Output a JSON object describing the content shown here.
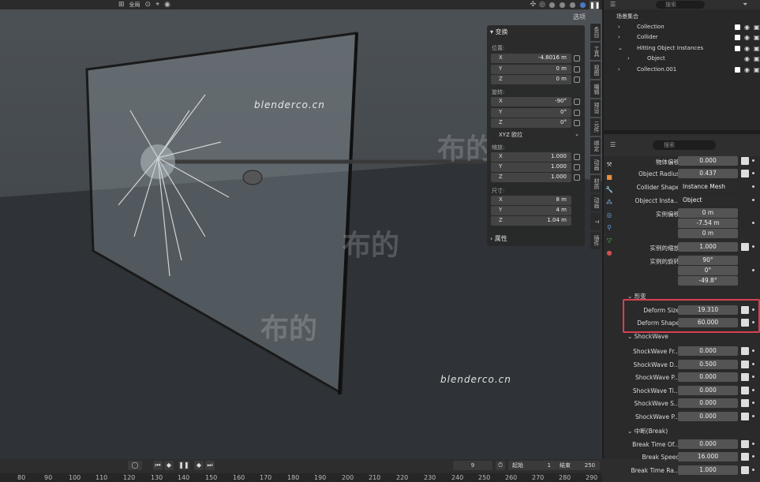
{
  "viewport": {
    "header": {
      "global_label": "全局",
      "options_label": "选项"
    },
    "watermarks": [
      "blenderco.cn",
      "blenderco.cn"
    ],
    "watermark_cn": [
      "布的",
      "布的",
      "布的"
    ],
    "npanel": {
      "title": "变换",
      "location_label": "位置:",
      "location": [
        {
          "axis": "X",
          "value": "-4.8016 m"
        },
        {
          "axis": "Y",
          "value": "0 m"
        },
        {
          "axis": "Z",
          "value": "0 m"
        }
      ],
      "rotation_label": "旋转:",
      "rotation": [
        {
          "axis": "X",
          "value": "-90°"
        },
        {
          "axis": "Y",
          "value": "0°"
        },
        {
          "axis": "Z",
          "value": "0°"
        }
      ],
      "rotation_mode": "XYZ 欧拉",
      "scale_label": "缩放:",
      "scale": [
        {
          "axis": "X",
          "value": "1.000"
        },
        {
          "axis": "Y",
          "value": "1.000"
        },
        {
          "axis": "Z",
          "value": "1.000"
        }
      ],
      "dimensions_label": "尺寸:",
      "dimensions": [
        {
          "axis": "X",
          "value": "8 m"
        },
        {
          "axis": "Y",
          "value": "4 m"
        },
        {
          "axis": "Z",
          "value": "1.04 m"
        }
      ],
      "properties_label": "属性"
    },
    "side_tabs": [
      "条目",
      "工具",
      "视图",
      "编辑",
      "预设",
      "元件",
      "绑定",
      "动画",
      "材质",
      "动画",
      "T",
      "插件"
    ]
  },
  "timeline": {
    "frame": "9",
    "start_label": "起始",
    "start_value": "1",
    "end_label": "结束",
    "end_value": "250",
    "ruler": [
      "80",
      "90",
      "100",
      "110",
      "120",
      "130",
      "140",
      "150",
      "160",
      "170",
      "180",
      "190",
      "200",
      "210",
      "220",
      "230",
      "240",
      "250",
      "260",
      "270",
      "280",
      "290"
    ]
  },
  "outliner": {
    "search_placeholder": "搜索",
    "rows": [
      {
        "label": "场景集合"
      },
      {
        "label": "Collection"
      },
      {
        "label": "Collider"
      },
      {
        "label": "Hitting Object Instances"
      },
      {
        "label": "Object"
      },
      {
        "label": "Collection.001"
      }
    ]
  },
  "properties": {
    "search_placeholder": "搜索",
    "rows": [
      {
        "label": "物体偏移",
        "value": "0.000"
      },
      {
        "label": "Object Radius",
        "value": "0.437"
      },
      {
        "label": "Collider Shape",
        "value": "Instance Mesh"
      },
      {
        "label": "Objecct Insta...",
        "value": "Object"
      },
      {
        "label": "实例偏移",
        "value": "0 m"
      },
      {
        "label": "",
        "value": "-7.54 m"
      },
      {
        "label": "",
        "value": "0 m"
      },
      {
        "label": "实例的缩放",
        "value": "1.000"
      },
      {
        "label": "实例的旋转",
        "value": "90°"
      },
      {
        "label": "",
        "value": "0°"
      },
      {
        "label": "",
        "value": "-49.8°"
      }
    ],
    "deform_section": "形变",
    "deform": [
      {
        "label": "Deform Size",
        "value": "19.310"
      },
      {
        "label": "Deform Shape",
        "value": "60.000"
      }
    ],
    "shockwave_section": "ShockWave",
    "shockwave": [
      {
        "label": "ShockWave Fr...",
        "value": "0.000"
      },
      {
        "label": "ShockWave D...",
        "value": "0.500"
      },
      {
        "label": "ShockWave P...",
        "value": "0.000"
      },
      {
        "label": "ShockWave Ti...",
        "value": "0.000"
      },
      {
        "label": "ShockWave S...",
        "value": "0.000"
      },
      {
        "label": "ShockWave P...",
        "value": "0.000"
      }
    ],
    "break_section": "中断(Break)",
    "break": [
      {
        "label": "Break Time Of...",
        "value": "0.000"
      },
      {
        "label": "Break Speed",
        "value": "16.000"
      },
      {
        "label": "Break Time Ra...",
        "value": "1.000"
      }
    ]
  }
}
